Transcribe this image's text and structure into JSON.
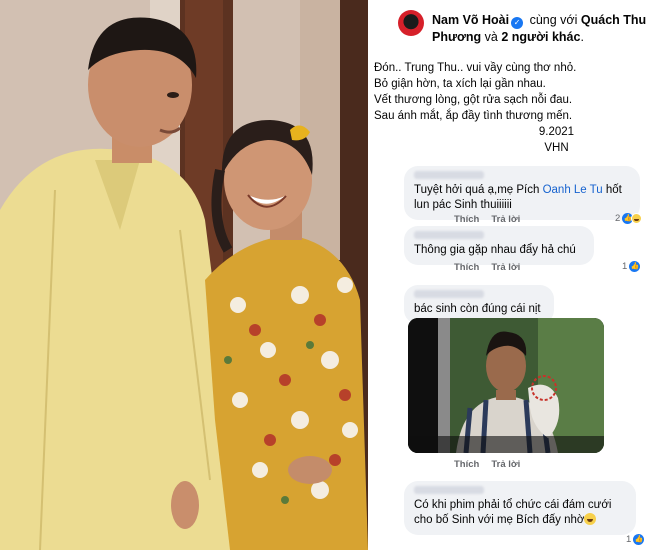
{
  "post": {
    "author": "Nam Võ Hoài",
    "with_text": "cùng với",
    "tagged": "Quách Thu Phương",
    "and_text": "và",
    "others": "2 người khác",
    "others_suffix": ".",
    "caption_lines": [
      "Đón.. Trung Thu.. vui vầy cùng thơ nhỏ.",
      "Bỏ giận hờn, ta xích lại gần nhau.",
      "Vết thương lòng, gột rửa sạch nỗi đau.",
      "Sau ánh mắt, ắp đầy tình thương mến."
    ],
    "signature_date": "9.2021",
    "signature_name": "VHN"
  },
  "comments": [
    {
      "text_before": "Tuyệt hởi quá ạ,mẹ Pích ",
      "mention": "Oanh Le Tu",
      "text_after": " hốt lun pác Sinh thuiiiiii",
      "like_label": "Thích",
      "reply_label": "Trả lời",
      "reaction_count": "2"
    },
    {
      "text": "Thông gia gặp nhau đẩy hả chú",
      "like_label": "Thích",
      "reply_label": "Trả lời",
      "reaction_count": "1"
    },
    {
      "text": "bác sinh còn đúng cái nịt",
      "like_label": "Thích",
      "reply_label": "Trả lời"
    },
    {
      "text": "Có khi phim phải tổ chức cái đám cưới cho bố Sinh với mẹ Bích đấy nhờ",
      "reaction_count": "1"
    }
  ],
  "colors": {
    "link": "#1763cf",
    "bubble_bg": "#f0f2f5",
    "verified": "#1877f2",
    "muted_text": "#65676b"
  },
  "icons": [
    "verified-badge-icon",
    "like-reaction-icon",
    "haha-reaction-icon",
    "laughing-emoji-icon"
  ]
}
